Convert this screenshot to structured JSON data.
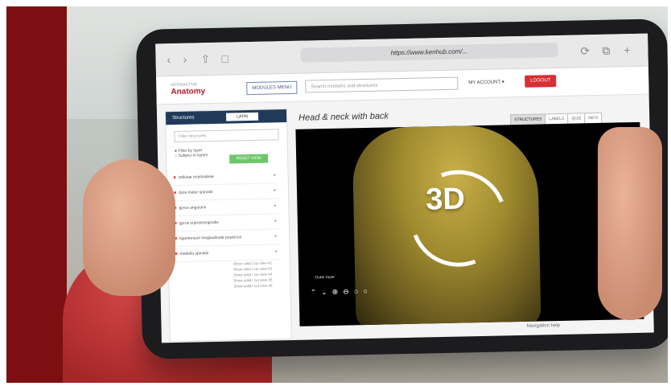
{
  "browser": {
    "url": "https://www.kenhub.com/..."
  },
  "app": {
    "logo_text": "Anatomy",
    "logo_subtext": "INTERACTIVE",
    "modules_button": "MODULES MENU",
    "search_placeholder": "Search modules and structures",
    "account_label": "MY ACCOUNT ▾",
    "logout_button": "LOGOUT"
  },
  "sidebar": {
    "title": "Structures",
    "language": "LATIN",
    "filter_placeholder": "Filter structures",
    "filter_option_1": "Filter by layer",
    "filter_option_2": "Subject to layers",
    "reset_button": "RESET VIEW",
    "items": [
      {
        "label": "cellulae mastoideae"
      },
      {
        "label": "dura mater spinalis"
      },
      {
        "label": "gyrus angularis"
      },
      {
        "label": "gyrus supramarginalis"
      },
      {
        "label": "ligamentum longitudinale posterius"
      },
      {
        "label": "medulla spinalis"
      }
    ],
    "subitems": [
      {
        "label": "Show solid / cut view #2"
      },
      {
        "label": "Show solid / cut view #3"
      },
      {
        "label": "Show solid / cut view #4"
      },
      {
        "label": "Show solid / cut view #5"
      },
      {
        "label": "Show solid / cut view #6"
      }
    ]
  },
  "main": {
    "title": "Head & neck with back",
    "tabs": [
      "STRUCTURES",
      "LABELS",
      "QUIZ",
      "INFO"
    ],
    "viewer_label": "3D",
    "outer_layer_label": "Outer layer",
    "navigation_help": "Navigation help"
  }
}
